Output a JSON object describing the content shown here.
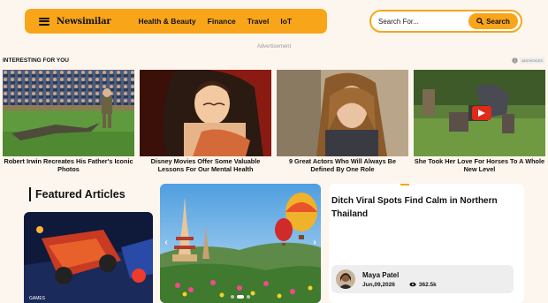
{
  "header": {
    "logo": "Newsimilar",
    "nav": [
      "Health & Beauty",
      "Finance",
      "Travel",
      "IoT"
    ],
    "search_placeholder": "Search For...",
    "search_button": "Search"
  },
  "ad_label": "Advertisement",
  "interesting": {
    "heading": "INTERESTING FOR YOU",
    "adchoices": "ADCHOICES",
    "cards": [
      {
        "title": "Robert Irwin Recreates His Father's Iconic Photos"
      },
      {
        "title": "Disney Movies Offer Some Valuable Lessons For Our Mental Health"
      },
      {
        "title": "9 Great Actors Who Will Always Be Defined By One Role"
      },
      {
        "title": "She Took Her Love For Horses To A Whole New Level"
      }
    ]
  },
  "featured": {
    "heading": "Featured Articles",
    "image_tag": "GAMES"
  },
  "carousel": {
    "prev_arrow": "‹",
    "next_arrow": "›",
    "slide_count": 3,
    "active_slide": 2
  },
  "article": {
    "title": "Ditch Viral Spots Find Calm in Northern Thailand",
    "author": "Maya Patel",
    "date": "Jun,09,2026",
    "views": "362.5k"
  },
  "colors": {
    "accent": "#f9a51a",
    "page_bg": "#fdf6ee"
  }
}
